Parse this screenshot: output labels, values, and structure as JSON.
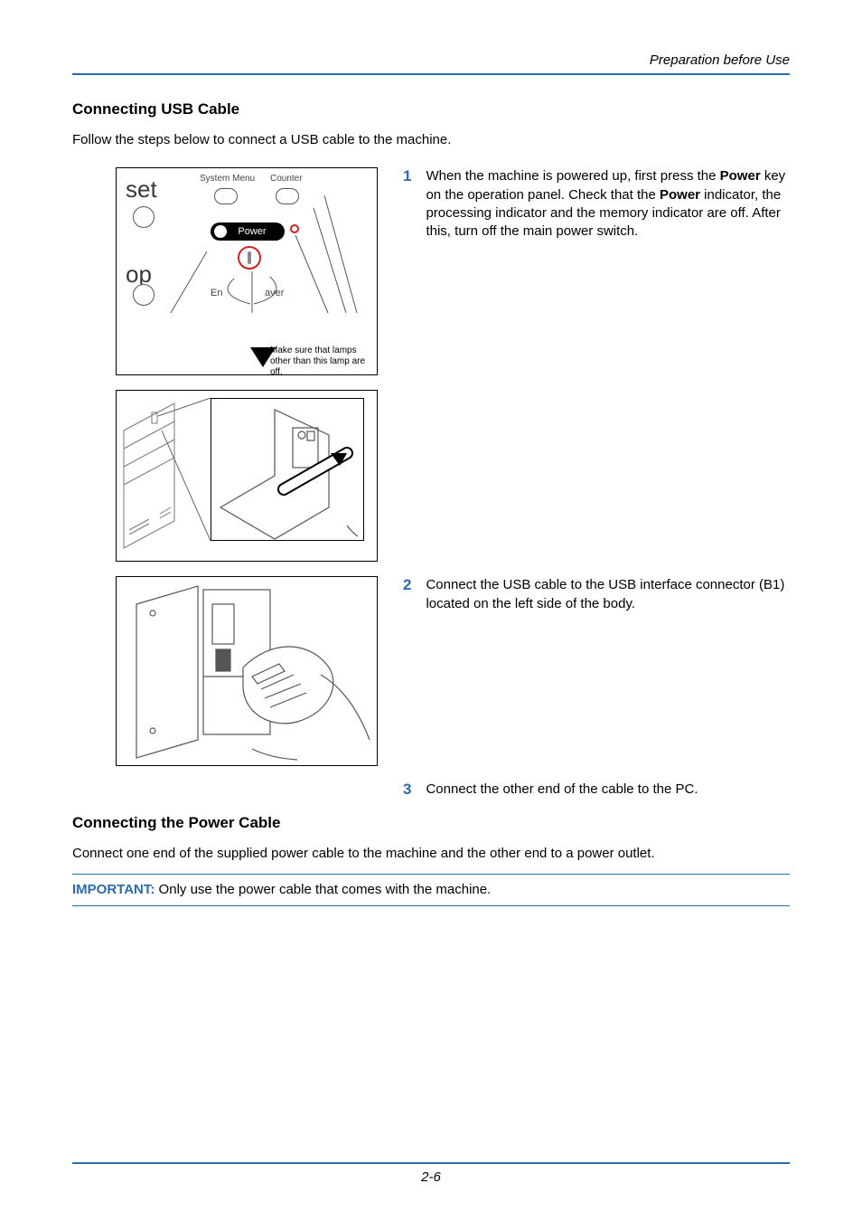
{
  "header": "Preparation before Use",
  "section1": {
    "title": "Connecting USB Cable",
    "intro": "Follow the steps below to connect a USB cable to the machine.",
    "step1": {
      "num": "1",
      "pre": "When the machine is powered up, first press the ",
      "b1": "Power",
      "mid": " key on the operation panel. Check that the ",
      "b2": "Power",
      "post": " indicator, the processing indicator and the memory indicator are off. After this, turn off the main power switch."
    },
    "step2": {
      "num": "2",
      "text": "Connect the USB cable to the USB interface connector (B1) located on the left side of the body."
    },
    "step3": {
      "num": "3",
      "text": "Connect the other end of the cable to the PC."
    }
  },
  "section2": {
    "title": "Connecting the Power Cable",
    "intro": "Connect one end of the supplied power cable to the machine and the other end to a power outlet.",
    "important_lead": "IMPORTANT:",
    "important_text": " Only use the power cable that comes with the machine."
  },
  "panel": {
    "set": "set",
    "op": "op",
    "sys": "System Menu",
    "cnt": "Counter",
    "power": "Power",
    "en": "En",
    "aver": "aver",
    "callout": "Make sure that lamps other than this lamp are off."
  },
  "footer": {
    "page": "2-6"
  }
}
